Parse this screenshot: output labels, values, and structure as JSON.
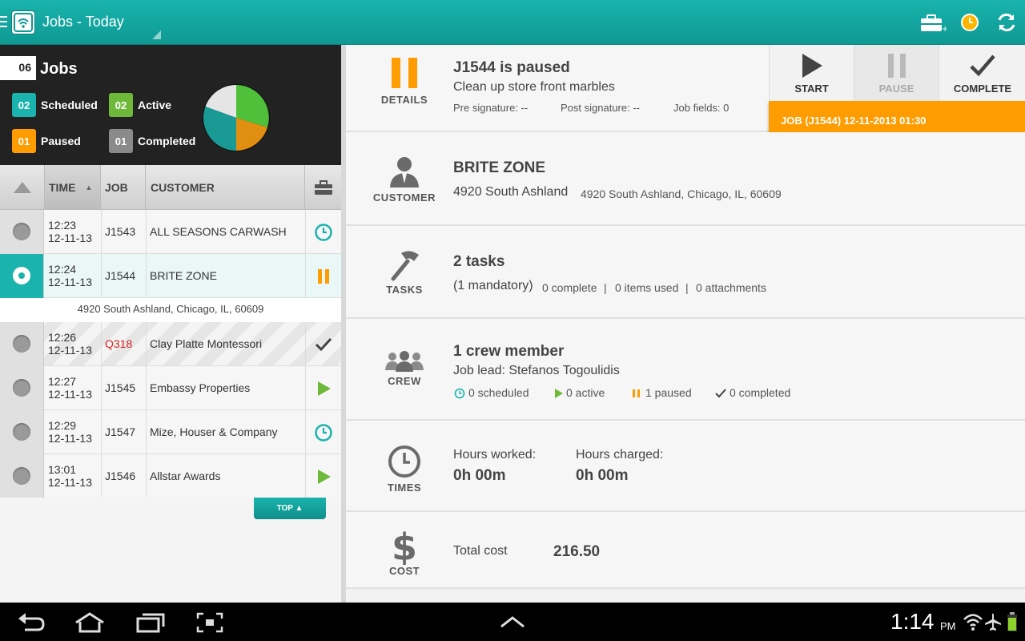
{
  "header": {
    "title": "Jobs - Today"
  },
  "summary": {
    "jobs_count": "06",
    "jobs_label": "Jobs",
    "stats": [
      {
        "num": "02",
        "label": "Scheduled",
        "color": "#1ab3ad"
      },
      {
        "num": "02",
        "label": "Active",
        "color": "#6fb93a"
      },
      {
        "num": "01",
        "label": "Paused",
        "color": "#ff9c00"
      },
      {
        "num": "01",
        "label": "Completed",
        "color": "#8a8a8a"
      }
    ]
  },
  "table": {
    "headers": {
      "time": "TIME",
      "job": "JOB",
      "customer": "CUSTOMER"
    },
    "rows": [
      {
        "time": "12:23",
        "date": "12-11-13",
        "job": "J1543",
        "customer": "ALL SEASONS CARWASH",
        "status": "scheduled"
      },
      {
        "time": "12:24",
        "date": "12-11-13",
        "job": "J1544",
        "customer": "BRITE ZONE",
        "status": "paused"
      },
      {
        "time": "12:26",
        "date": "12-11-13",
        "job": "Q318",
        "customer": "Clay Platte Montessori",
        "status": "completed"
      },
      {
        "time": "12:27",
        "date": "12-11-13",
        "job": "J1545",
        "customer": "Embassy Properties",
        "status": "active"
      },
      {
        "time": "12:29",
        "date": "12-11-13",
        "job": "J1547",
        "customer": "Mize, Houser & Company",
        "status": "scheduled"
      },
      {
        "time": "13:01",
        "date": "12-11-13",
        "job": "J1546",
        "customer": "Allstar Awards",
        "status": "active"
      }
    ],
    "selected_address": "4920 South Ashland, Chicago, IL, 60609",
    "top_button": "TOP ▲"
  },
  "details": {
    "caption": "DETAILS",
    "title": "J1544 is paused",
    "subtitle": "Clean up store front marbles",
    "pre_sig": "Pre signature:  --",
    "post_sig": "Post signature:  --",
    "job_fields": "Job fields:  0"
  },
  "actions": {
    "start": "START",
    "pause": "PAUSE",
    "complete": "COMPLETE",
    "banner": "JOB   (J1544) 12-11-2013 01:30"
  },
  "customer": {
    "caption": "CUSTOMER",
    "name": "BRITE ZONE",
    "short_addr": "4920 South Ashland",
    "full_addr": "4920 South Ashland, Chicago, IL, 60609"
  },
  "tasks": {
    "caption": "TASKS",
    "title": "2 tasks",
    "mandatory": "(1 mandatory)",
    "complete": "0 complete",
    "sep": "|",
    "items": "0 items used",
    "attachments": "0 attachments"
  },
  "crew": {
    "caption": "CREW",
    "title": "1 crew member",
    "lead": "Job lead: Stefanos Togoulidis",
    "scheduled": "0 scheduled",
    "active": "0 active",
    "paused": "1 paused",
    "completed": "0 completed"
  },
  "times": {
    "caption": "TIMES",
    "worked_label": "Hours worked:",
    "worked_value": "0h 00m",
    "charged_label": "Hours charged:",
    "charged_value": "0h 00m"
  },
  "cost": {
    "caption": "COST",
    "label": "Total cost",
    "value": "216.50"
  },
  "statusbar": {
    "time": "1:14",
    "ampm": "PM"
  },
  "colors": {
    "accent": "#1ab3ad",
    "paused": "#ff9c00",
    "active": "#6fb93a"
  }
}
